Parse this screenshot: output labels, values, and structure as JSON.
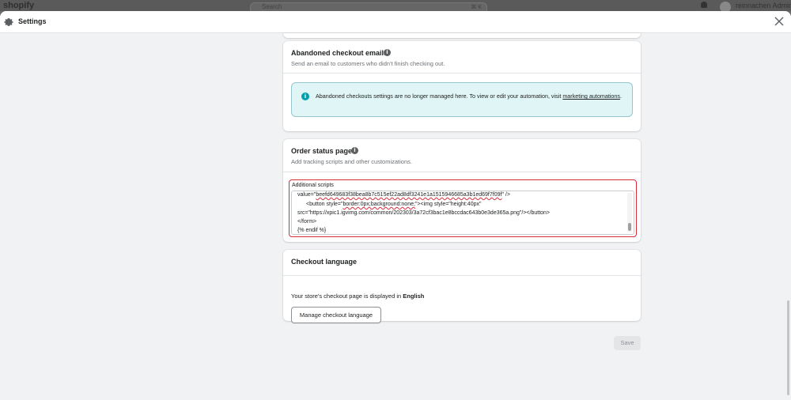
{
  "topbar": {
    "logo": "shopify",
    "search_placeholder": "Search",
    "search_shortcut": "⌘ K",
    "store_name": "reinnachen Admin"
  },
  "header": {
    "title": "Settings",
    "icon": "gear-icon",
    "close_icon": "close-icon"
  },
  "abandoned": {
    "title": "Abandoned checkout emails",
    "subtitle": "Send an email to customers who didn't finish checking out.",
    "banner_text": "Abandoned checkouts settings are no longer managed here. To view or edit your automation, visit ",
    "banner_link": "marketing automations",
    "banner_end": "."
  },
  "order_status": {
    "title": "Order status page",
    "subtitle": "Add tracking scripts and other customizations.",
    "scripts_label": "Additional scripts",
    "code": {
      "l1_a": "value=\"",
      "l1_b": "beefd649683f38bea8b7c515ef22ad8df3241e1a1515946685a3b1ed69f7f09f",
      "l1_c": "\" />",
      "l2_a": "<button style=\"",
      "l2_b": "border:0px;background:none;",
      "l2_c": "\"><img style=\"height:40px\"",
      "l3": "src=\"https://xpic1.igvimg.com/common/202303/3a72cf3bac1e8bccdac643b0e3de365a.png\"/></button>",
      "l4": "</form>",
      "l5": "{% endif %}"
    }
  },
  "checkout_language": {
    "title": "Checkout language",
    "text": "Your store's checkout page is displayed in ",
    "language": "English",
    "button": "Manage checkout language"
  },
  "save_button": "Save",
  "colors": {
    "highlight_border": "#d82c3d",
    "banner_bg": "#e0f5f5",
    "banner_icon": "#00a0ac"
  }
}
